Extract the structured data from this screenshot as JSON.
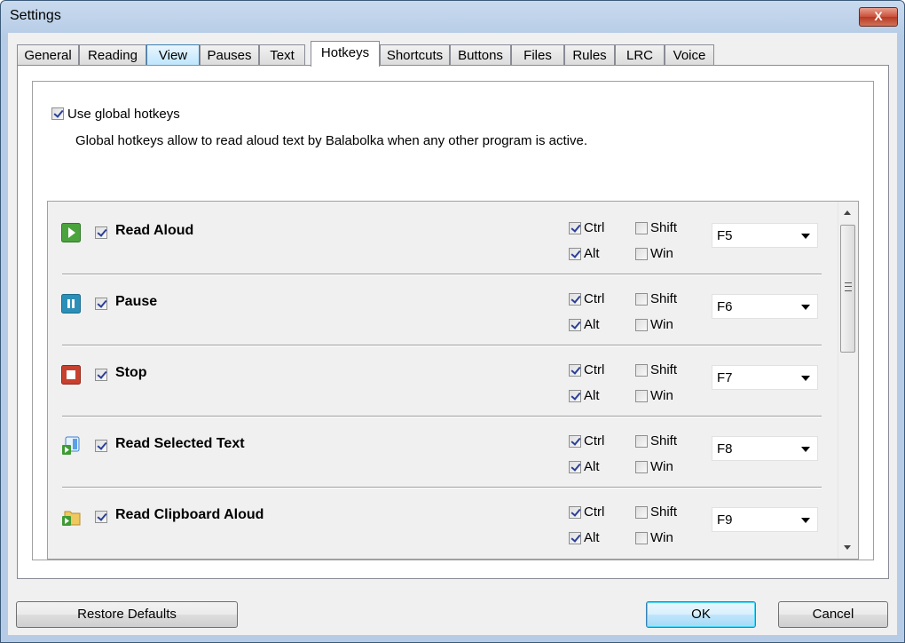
{
  "window": {
    "title": "Settings",
    "close_label": "X"
  },
  "tabs": [
    {
      "label": "General"
    },
    {
      "label": "Reading"
    },
    {
      "label": "View",
      "state": "hover"
    },
    {
      "label": "Pauses"
    },
    {
      "label": "Text"
    },
    {
      "label": "Hotkeys",
      "state": "active"
    },
    {
      "label": "Shortcuts"
    },
    {
      "label": "Buttons"
    },
    {
      "label": "Files"
    },
    {
      "label": "Rules"
    },
    {
      "label": "LRC"
    },
    {
      "label": "Voice"
    }
  ],
  "hotkeys": {
    "use_global": {
      "label": "Use global hotkeys",
      "checked": true
    },
    "description": "Global hotkeys allow to read aloud text by Balabolka when any other program is active.",
    "modifier_labels": {
      "ctrl": "Ctrl",
      "alt": "Alt",
      "shift": "Shift",
      "win": "Win"
    },
    "items": [
      {
        "name": "Read Aloud",
        "icon": "play-icon",
        "enabled": true,
        "ctrl": true,
        "alt": true,
        "shift": false,
        "win": false,
        "key": "F5"
      },
      {
        "name": "Pause",
        "icon": "pause-icon",
        "enabled": true,
        "ctrl": true,
        "alt": true,
        "shift": false,
        "win": false,
        "key": "F6"
      },
      {
        "name": "Stop",
        "icon": "stop-icon",
        "enabled": true,
        "ctrl": true,
        "alt": true,
        "shift": false,
        "win": false,
        "key": "F7"
      },
      {
        "name": "Read Selected Text",
        "icon": "read-selected-icon",
        "enabled": true,
        "ctrl": true,
        "alt": true,
        "shift": false,
        "win": false,
        "key": "F8"
      },
      {
        "name": "Read Clipboard Aloud",
        "icon": "read-clipboard-icon",
        "enabled": true,
        "ctrl": true,
        "alt": true,
        "shift": false,
        "win": false,
        "key": "F9"
      }
    ]
  },
  "buttons": {
    "restore": "Restore Defaults",
    "ok": "OK",
    "cancel": "Cancel"
  }
}
